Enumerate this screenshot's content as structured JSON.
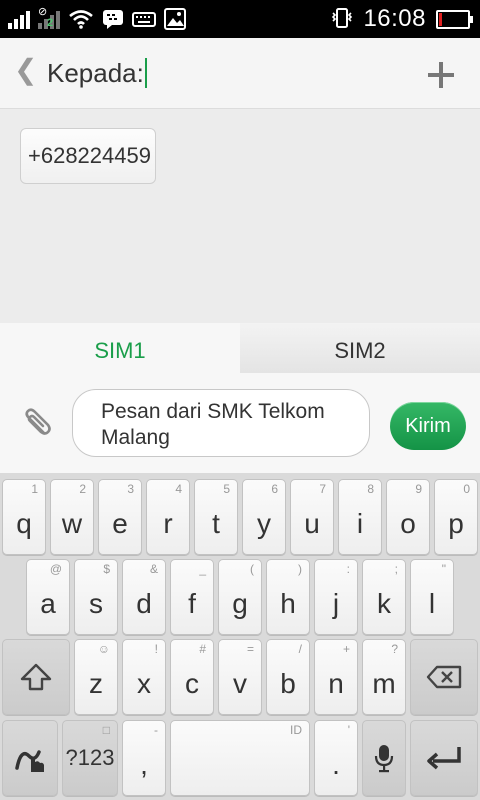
{
  "status_bar": {
    "time": "16:08",
    "sim2_badge": "2",
    "battery_level_percent": 10,
    "icons": [
      "signal-icon",
      "signal-2-icon",
      "wifi-icon",
      "bbm-icon",
      "keyboard-icon",
      "image-icon",
      "vibrate-icon",
      "battery-icon"
    ]
  },
  "header": {
    "to_label": "Kepada:"
  },
  "recipients": [
    {
      "label": "+628224459"
    }
  ],
  "sim_tabs": [
    {
      "label": "SIM1",
      "active": true
    },
    {
      "label": "SIM2",
      "active": false
    }
  ],
  "compose": {
    "message": "Pesan dari SMK Telkom Malang",
    "send_label": "Kirim"
  },
  "keyboard": {
    "row1": [
      {
        "key": "q",
        "sub": "1"
      },
      {
        "key": "w",
        "sub": "2"
      },
      {
        "key": "e",
        "sub": "3"
      },
      {
        "key": "r",
        "sub": "4"
      },
      {
        "key": "t",
        "sub": "5"
      },
      {
        "key": "y",
        "sub": "6"
      },
      {
        "key": "u",
        "sub": "7"
      },
      {
        "key": "i",
        "sub": "8"
      },
      {
        "key": "o",
        "sub": "9"
      },
      {
        "key": "p",
        "sub": "0"
      }
    ],
    "row2": [
      {
        "key": "a",
        "sub": "@"
      },
      {
        "key": "s",
        "sub": "$"
      },
      {
        "key": "d",
        "sub": "&"
      },
      {
        "key": "f",
        "sub": "_"
      },
      {
        "key": "g",
        "sub": "("
      },
      {
        "key": "h",
        "sub": ")"
      },
      {
        "key": "j",
        "sub": ":"
      },
      {
        "key": "k",
        "sub": ";"
      },
      {
        "key": "l",
        "sub": "\""
      }
    ],
    "row3": [
      {
        "key": "z",
        "sub": "☺"
      },
      {
        "key": "x",
        "sub": "!"
      },
      {
        "key": "c",
        "sub": "#"
      },
      {
        "key": "v",
        "sub": "="
      },
      {
        "key": "b",
        "sub": "/"
      },
      {
        "key": "n",
        "sub": "+"
      },
      {
        "key": "m",
        "sub": "?"
      }
    ],
    "symbols_label": "?123",
    "comma": ",",
    "comma_sub": "-",
    "space_sub": "ID",
    "period": ".",
    "period_sub": "'"
  },
  "colors": {
    "accent": "#1a9e4a",
    "status_bar": "#000000",
    "battery_low": "#e02020"
  }
}
